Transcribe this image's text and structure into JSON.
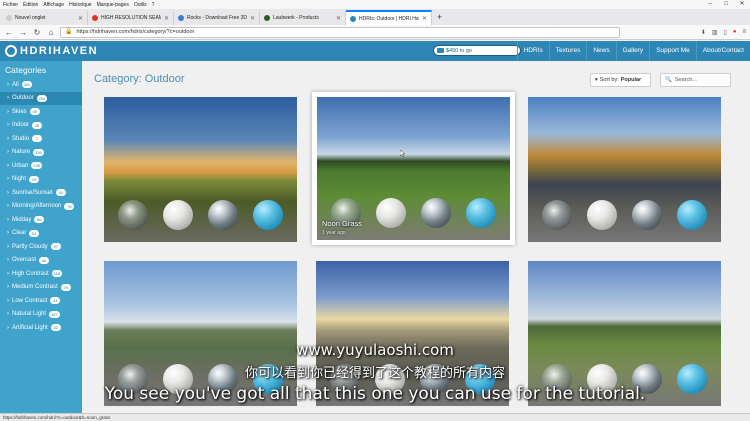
{
  "browser": {
    "menu": [
      "Fichier",
      "Édition",
      "Affichage",
      "Historique",
      "Marque-pages",
      "Outils",
      "?"
    ],
    "tabs": [
      {
        "title": "Nouvel onglet",
        "active": false,
        "color": "#e8e8ea"
      },
      {
        "title": "HIGH RESOLUTION SEAMLESS",
        "active": false,
        "color": "#e0312f"
      },
      {
        "title": "Rocks - Download Free 3D mo",
        "active": false,
        "color": "#3a7bd5"
      },
      {
        "title": "Laubwerk - Products",
        "active": false,
        "color": "#2d5a27"
      },
      {
        "title": "HDRIs: Outdoor | HDRI Haven",
        "active": true,
        "color": "#2e86b5"
      }
    ],
    "new_tab": "+",
    "url": "https://hdrihaven.com/hdris/category/?c=outdoor",
    "status_url": "https://hdrihaven.com/hdri/?c=outdoor&h=noon_grass"
  },
  "site": {
    "logo_text": "HDRIHAVEN",
    "patreon_text": "$450 to go",
    "nav": [
      "HDRIs",
      "Textures",
      "News",
      "Gallery",
      "Support Me",
      "About/Contact"
    ]
  },
  "sidebar": {
    "title": "Categories",
    "items": [
      {
        "label": "All",
        "count": "300"
      },
      {
        "label": "Outdoor",
        "count": "200",
        "active": true
      },
      {
        "label": "Skies",
        "count": "49"
      },
      {
        "label": "Indoor",
        "count": "38"
      },
      {
        "label": "Studio",
        "count": "7"
      },
      {
        "label": "Nature",
        "count": "136"
      },
      {
        "label": "Urban",
        "count": "108"
      },
      {
        "label": "Night",
        "count": "19"
      },
      {
        "label": "Sunrise/Sunset",
        "count": "40"
      },
      {
        "label": "Morning/Afternoon",
        "count": "78"
      },
      {
        "label": "Midday",
        "count": "86"
      },
      {
        "label": "Clear",
        "count": "51"
      },
      {
        "label": "Partly Cloudy",
        "count": "97"
      },
      {
        "label": "Overcast",
        "count": "46"
      },
      {
        "label": "High Contrast",
        "count": "118"
      },
      {
        "label": "Medium Contrast",
        "count": "79"
      },
      {
        "label": "Low Contrast",
        "count": "41"
      },
      {
        "label": "Natural Light",
        "count": "187"
      },
      {
        "label": "Artificial Light",
        "count": "32"
      }
    ]
  },
  "main": {
    "title": "Category: Outdoor",
    "sort_label": "Sort by:",
    "sort_value": "Popular",
    "search_placeholder": "Search...",
    "cards": [
      {
        "name": "",
        "sub": ""
      },
      {
        "name": "Noon Grass",
        "sub": "1 year ago"
      },
      {
        "name": "",
        "sub": ""
      },
      {
        "name": "",
        "sub": ""
      },
      {
        "name": "",
        "sub": ""
      },
      {
        "name": "",
        "sub": ""
      }
    ]
  },
  "subtitles": {
    "line1": "www.yuyulaoshi.com",
    "line2": "你可以看到你已经得到了这个教程的所有内容",
    "line3": "You see you've got all that this one you can use for the tutorial."
  },
  "colors": {
    "brand": "#2e86b5",
    "sidebar": "#3fa3cc",
    "title": "#4d8eb0"
  }
}
